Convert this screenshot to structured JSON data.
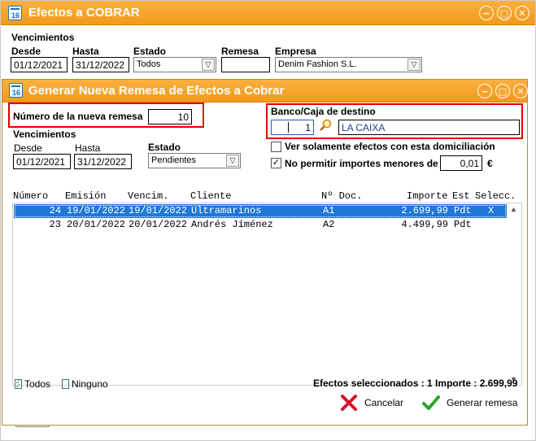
{
  "background_window": {
    "title": "Efectos a COBRAR",
    "section_label": "Vencimientos",
    "desde_label": "Desde",
    "desde_value": "01/12/2021",
    "hasta_label": "Hasta",
    "hasta_value": "31/12/2022",
    "estado_label": "Estado",
    "estado_value": "Todos",
    "remesa_label": "Remesa",
    "remesa_value": "",
    "empresa_label": "Empresa",
    "empresa_value": "Denim Fashion S.L."
  },
  "dialog": {
    "title": "Generar Nueva Remesa de Efectos a Cobrar",
    "numero_label": "Número de la nueva remesa",
    "numero_value": "10",
    "banco_label": "Banco/Caja de destino",
    "banco_code": "1",
    "banco_name": "LA CAIXA",
    "vencimientos_label": "Vencimientos",
    "desde_label": "Desde",
    "desde_value": "01/12/2021",
    "hasta_label": "Hasta",
    "hasta_value": "31/12/2022",
    "estado_label": "Estado",
    "estado_value": "Pendientes",
    "solo_domiciliacion_label": "Ver solamente efectos con esta domiciliación",
    "solo_domiciliacion_checked": false,
    "no_permitir_label": "No permitir importes menores de",
    "no_permitir_checked": true,
    "no_permitir_value": "0,01",
    "currency": "€",
    "table": {
      "headers": [
        "Número",
        "Emisión",
        "Vencim.",
        "Cliente",
        "Nº Doc.",
        "Importe",
        "Est",
        "Selecc."
      ],
      "rows": [
        {
          "numero": "24",
          "emision": "19/01/2022",
          "vencim": "19/01/2022",
          "cliente": "Ultramarinos",
          "doc": "A1",
          "importe": "2.699,99",
          "est": "Pdt",
          "selecc": "X",
          "selected": true
        },
        {
          "numero": "23",
          "emision": "20/01/2022",
          "vencim": "20/01/2022",
          "cliente": "Andrés Jíménez",
          "doc": "A2",
          "importe": "4.499,99",
          "est": "Pdt",
          "selecc": "",
          "selected": false
        }
      ]
    },
    "todos_label": "Todos",
    "ninguno_label": "Ninguno",
    "summary": "Efectos seleccionados : 1 Importe : 2.699,99",
    "cancel_label": "Cancelar",
    "generate_label": "Generar remesa"
  },
  "colors": {
    "titlebar": "#f29a1c",
    "highlight": "#e00000",
    "selection": "#1f78d6"
  }
}
